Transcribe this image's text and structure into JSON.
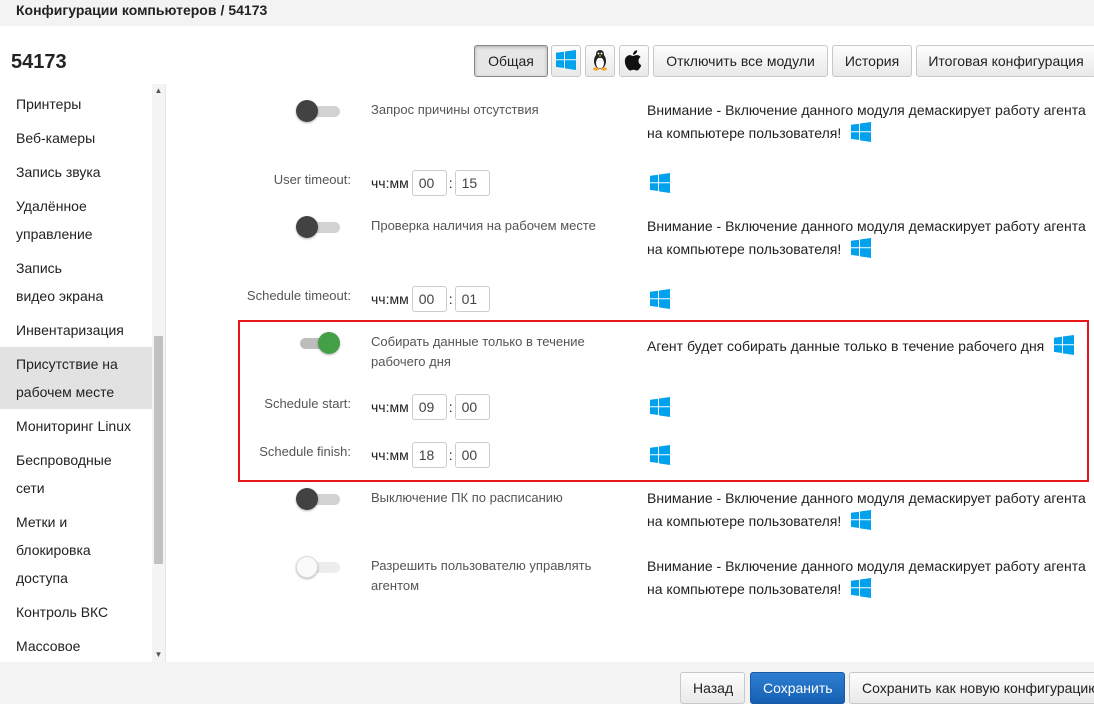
{
  "breadcrumb": {
    "parent": "Конфигурации компьютеров",
    "separator": "/",
    "current": "54173"
  },
  "page_title": "54173",
  "toolbar": {
    "general_label": "Общая",
    "disable_all_label": "Отключить все модули",
    "history_label": "История",
    "final_config_label": "Итоговая конфигурация",
    "os_icons": [
      "windows-icon",
      "linux-icon",
      "apple-icon"
    ]
  },
  "sidebar": {
    "items": [
      {
        "label": "Принтеры"
      },
      {
        "label": "Веб-камеры"
      },
      {
        "label": "Запись звука"
      },
      {
        "label": "Удалённое управление"
      },
      {
        "label": "Запись видео экрана"
      },
      {
        "label": "Инвентаризация"
      },
      {
        "label": "Присутствие на рабочем месте",
        "active": true
      },
      {
        "label": "Мониторинг Linux"
      },
      {
        "label": "Беспроводные сети"
      },
      {
        "label": "Метки и блокировка доступа"
      },
      {
        "label": "Контроль ВКС"
      },
      {
        "label": "Массовое"
      }
    ]
  },
  "settings": {
    "absence_reason": {
      "label": "Запрос причины отсутствия",
      "enabled": false,
      "warning": "Внимание - Включение данного модуля демаскирует работу агента на компьютере пользователя!"
    },
    "user_timeout": {
      "label": "User timeout:",
      "unit": "чч:мм",
      "hours": "00",
      "minutes": "15"
    },
    "workplace_check": {
      "label": "Проверка наличия на рабочем месте",
      "enabled": false,
      "warning": "Внимание - Включение данного модуля демаскирует работу агента на компьютере пользователя!"
    },
    "schedule_timeout": {
      "label": "Schedule timeout:",
      "unit": "чч:мм",
      "hours": "00",
      "minutes": "01"
    },
    "workday_only": {
      "label": "Собирать данные только в течение рабочего дня",
      "enabled": true,
      "note": "Агент будет собирать данные только в течение рабочего дня"
    },
    "schedule_start": {
      "label": "Schedule start:",
      "unit": "чч:мм",
      "hours": "09",
      "minutes": "00"
    },
    "schedule_finish": {
      "label": "Schedule finish:",
      "unit": "чч:мм",
      "hours": "18",
      "minutes": "00"
    },
    "scheduled_shutdown": {
      "label": "Выключение ПК по расписанию",
      "enabled": false,
      "warning": "Внимание - Включение данного модуля демаскирует работу агента на компьютере пользователя!"
    },
    "user_control_agent": {
      "label": "Разрешить пользователю управлять агентом",
      "enabled": false,
      "disabled": true,
      "warning": "Внимание - Включение данного модуля демаскирует работу агента на компьютере пользователя!"
    }
  },
  "footer": {
    "back_label": "Назад",
    "save_label": "Сохранить",
    "save_as_new_label": "Сохранить как новую конфигурацию"
  },
  "colors": {
    "toggle_on": "#43a047",
    "toggle_off": "#424242",
    "windows_blue": "#00a2ed",
    "primary_button": "#1a6ec3",
    "highlight_border": "#e8161b"
  }
}
